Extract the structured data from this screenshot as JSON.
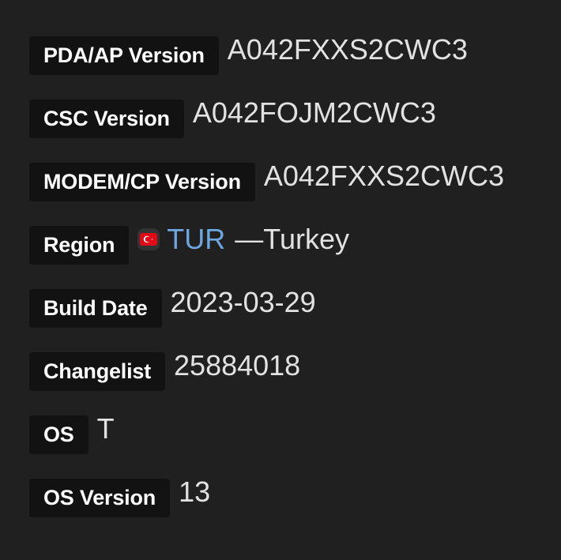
{
  "rows": [
    {
      "label": "PDA/AP Version",
      "value": "A042FXXS2CWC3"
    },
    {
      "label": "CSC Version",
      "value": "A042FOJM2CWC3"
    },
    {
      "label": "MODEM/CP Version",
      "value": "A042FXXS2CWC3"
    },
    {
      "label": "Region",
      "code": "TUR",
      "name": "—Turkey",
      "flag_icon": "turkey-flag-icon"
    },
    {
      "label": "Build Date",
      "value": "2023-03-29"
    },
    {
      "label": "Changelist",
      "value": "25884018"
    },
    {
      "label": "OS",
      "value": "T"
    },
    {
      "label": "OS Version",
      "value": "13"
    }
  ],
  "colors": {
    "background": "#202020",
    "label_background": "#121212",
    "label_text": "#ffffff",
    "value_text": "#e2e2e2",
    "region_code": "#6ea6e0",
    "flag_red": "#e30a17"
  }
}
